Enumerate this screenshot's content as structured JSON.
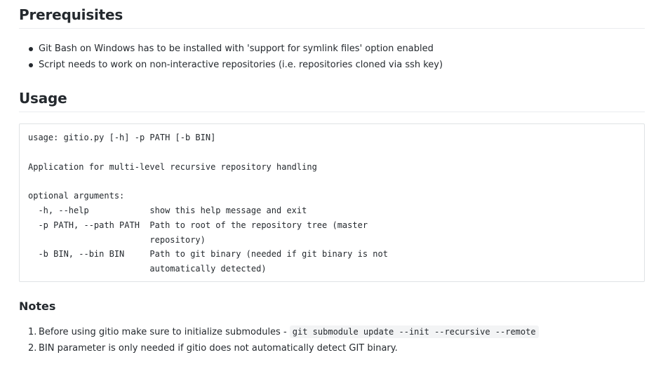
{
  "prerequisites": {
    "heading": "Prerequisites",
    "items": [
      "Git Bash on Windows has to be installed with 'support for symlink files' option enabled",
      "Script needs to work on non-interactive repositories (i.e. repositories cloned via ssh key)"
    ]
  },
  "usage": {
    "heading": "Usage",
    "code_lines": [
      "usage: gitio.py [-h] -p PATH [-b BIN]",
      "",
      "Application for multi-level recursive repository handling",
      "",
      "optional arguments:",
      "  -h, --help            show this help message and exit",
      "  -p PATH, --path PATH  Path to root of the repository tree (master",
      "                        repository)",
      "  -b BIN, --bin BIN     Path to git binary (needed if git binary is not",
      "                        automatically detected)"
    ]
  },
  "notes": {
    "heading": "Notes",
    "items": [
      {
        "number": "1.",
        "text": "Before using gitio make sure to initialize submodules - ",
        "code": "git submodule update --init --recursive --remote"
      },
      {
        "number": "2.",
        "text": "BIN parameter is only needed if gitio does not automatically detect GIT binary.",
        "code": ""
      }
    ]
  }
}
